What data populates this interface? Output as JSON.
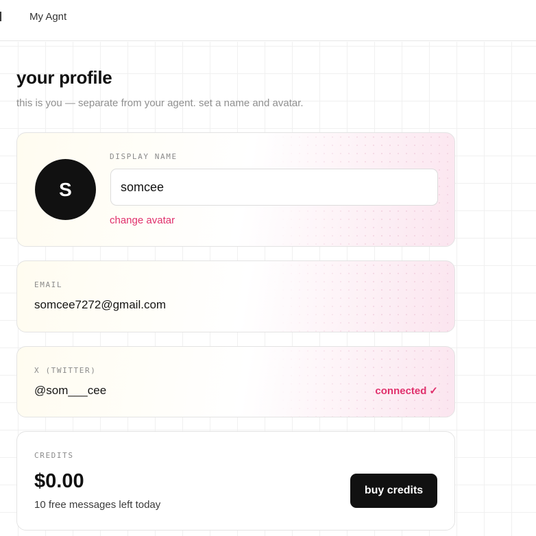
{
  "nav": {
    "links": [
      "My Agnt"
    ]
  },
  "page": {
    "title": "your profile",
    "subtitle": "this is you — separate from your agent. set a name and avatar."
  },
  "profile": {
    "avatar_initial": "S",
    "display_name_label": "DISPLAY NAME",
    "display_name_value": "somcee",
    "change_avatar_label": "change avatar"
  },
  "email": {
    "label": "EMAIL",
    "value": "somcee7272@gmail.com"
  },
  "twitter": {
    "label": "X (TWITTER)",
    "handle": "@som___cee",
    "status": "connected",
    "status_icon": "✓"
  },
  "credits": {
    "label": "CREDITS",
    "amount": "$0.00",
    "note": "10 free messages left today",
    "buy_label": "buy credits"
  },
  "colors": {
    "accent": "#e0306c",
    "primary_dark": "#111111",
    "muted_text": "#8f8f8f"
  },
  "icons": {
    "status_check": "checkmark-icon"
  }
}
